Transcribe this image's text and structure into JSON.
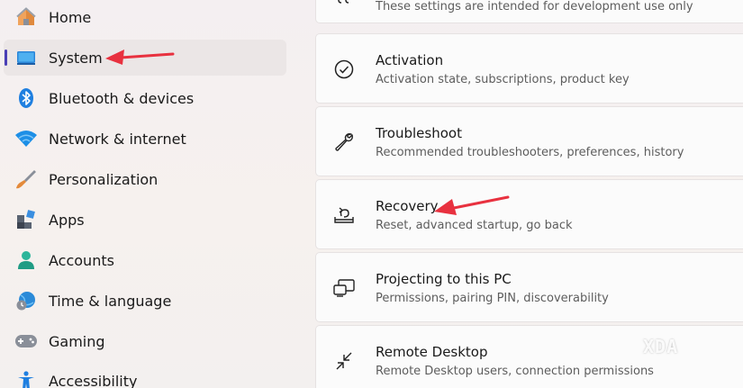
{
  "sidebar": {
    "items": [
      {
        "label": "Home",
        "icon": "home-icon"
      },
      {
        "label": "System",
        "icon": "monitor-icon",
        "selected": true
      },
      {
        "label": "Bluetooth & devices",
        "icon": "bluetooth-icon"
      },
      {
        "label": "Network & internet",
        "icon": "wifi-icon"
      },
      {
        "label": "Personalization",
        "icon": "brush-icon"
      },
      {
        "label": "Apps",
        "icon": "apps-icon"
      },
      {
        "label": "Accounts",
        "icon": "person-icon"
      },
      {
        "label": "Time & language",
        "icon": "globe-clock-icon"
      },
      {
        "label": "Gaming",
        "icon": "gamepad-icon"
      },
      {
        "label": "Accessibility",
        "icon": "accessibility-icon"
      }
    ]
  },
  "main": {
    "items": [
      {
        "title": "",
        "description": "These settings are intended for development use only",
        "icon": "developer-tools-icon"
      },
      {
        "title": "Activation",
        "description": "Activation state, subscriptions, product key",
        "icon": "check-circle-icon"
      },
      {
        "title": "Troubleshoot",
        "description": "Recommended troubleshooters, preferences, history",
        "icon": "wrench-icon"
      },
      {
        "title": "Recovery",
        "description": "Reset, advanced startup, go back",
        "icon": "recovery-icon"
      },
      {
        "title": "Projecting to this PC",
        "description": "Permissions, pairing PIN, discoverability",
        "icon": "projecting-icon"
      },
      {
        "title": "Remote Desktop",
        "description": "Remote Desktop users, connection permissions",
        "icon": "remote-desktop-icon"
      }
    ]
  },
  "annotations": {
    "arrow_color": "#e8313f",
    "watermark": "XDA"
  },
  "colors": {
    "accent": "#4a3fb6",
    "selected_bg": "#ebe6e6",
    "card_bg": "#fbfbfb"
  }
}
